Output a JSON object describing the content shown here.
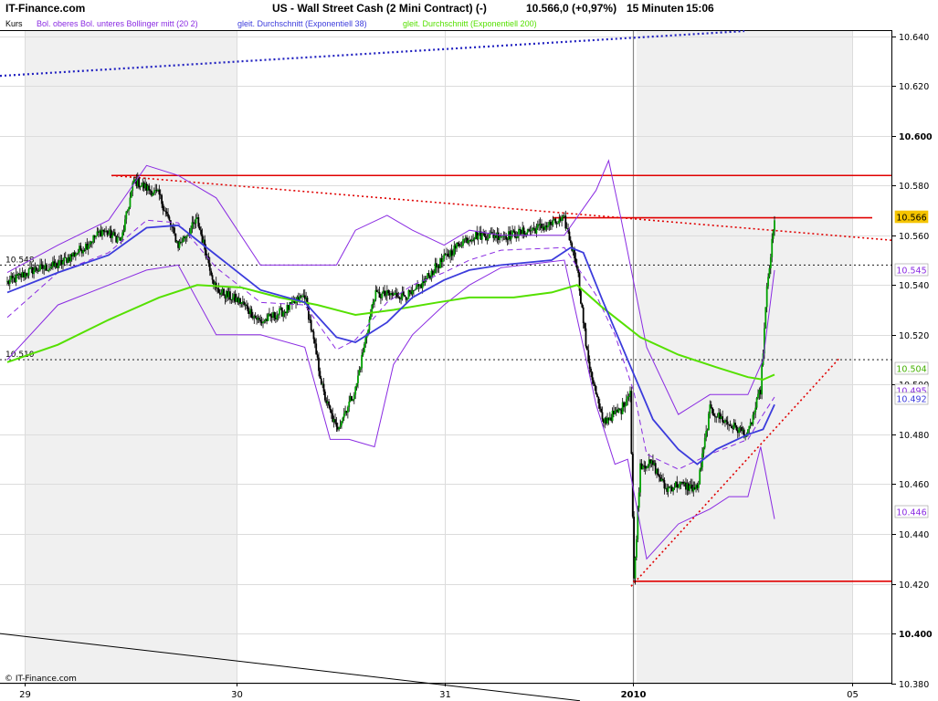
{
  "header": {
    "site": "IT-Finance.com",
    "title": "US - Wall Street Cash (2 Mini Contract) (-)",
    "quote": "10.566,0 (+0,97%)",
    "interval": "15 Minuten",
    "time": "15:06"
  },
  "legend": [
    {
      "text": "Kurs",
      "color": "#000000"
    },
    {
      "text": "Bol. oberes Bol. unteres Bollinger mitt (20 2)",
      "color": "#8a2be2"
    },
    {
      "text": "gleit. Durchschnitt (Exponentiell 38)",
      "color": "#3c3cdc"
    },
    {
      "text": "gleit. Durchschnitt (Exponentiell 200)",
      "color": "#55e000"
    }
  ],
  "copyright": "© IT-Finance.com",
  "colors": {
    "up_candle": "#00a000",
    "down_candle": "#000000",
    "bollinger": "#8a2be2",
    "ema38": "#3c3cdc",
    "ema200": "#55e000",
    "trend": "#e00000",
    "dotted_blue": "#2020c0",
    "shade": "#f0f0f0",
    "price_tag": "#f5c400"
  },
  "chart_data": {
    "type": "candlestick",
    "title": "US - Wall Street Cash (2 Mini Contract) (-)",
    "interval": "15 Minuten",
    "x_ticks": [
      "29",
      "30",
      "31",
      "2010",
      "05"
    ],
    "y_ticks": [
      "10.640",
      "10.620",
      "10.600",
      "10.580",
      "10.560",
      "10.540",
      "10.520",
      "10.500",
      "10.480",
      "10.460",
      "10.440",
      "10.420",
      "10.400",
      "10.380"
    ],
    "ylim": [
      10373,
      10645
    ],
    "current_price": 10566,
    "right_tags": [
      {
        "text": "10.566",
        "value": 10566,
        "kind": "price"
      },
      {
        "text": "10.545",
        "value": 10545,
        "kind": "bollinger"
      },
      {
        "text": "10.504",
        "value": 10504,
        "kind": "ema200"
      },
      {
        "text": "10.495",
        "value": 10495,
        "kind": "bollinger"
      },
      {
        "text": "10.492",
        "value": 10492,
        "kind": "ema38"
      },
      {
        "text": "10.446",
        "value": 10446,
        "kind": "bollinger"
      }
    ],
    "horizontal_lines": [
      {
        "label": "10.548",
        "value": 10548,
        "style": "dotted-black"
      },
      {
        "label": "10.510",
        "value": 10510,
        "style": "dotted-black"
      },
      {
        "value": 10584,
        "style": "solid-red"
      },
      {
        "value": 10567,
        "style": "solid-red"
      },
      {
        "value": 10421,
        "style": "solid-red"
      }
    ],
    "segments": [
      {
        "from": [
          0,
          10584
        ],
        "to": [
          1,
          10558
        ],
        "style": "dotted-red"
      },
      {
        "from": [
          0,
          10419
        ],
        "to": [
          1,
          10511
        ],
        "style": "dotted-red"
      },
      {
        "from": [
          0,
          10624
        ],
        "to": [
          1,
          10642
        ],
        "style": "dotted-blue"
      },
      {
        "from": [
          0,
          10400
        ],
        "to": [
          1,
          10373
        ],
        "style": "solid-black"
      }
    ],
    "anchors": [
      {
        "i": 0,
        "v": 10541
      },
      {
        "i": 20,
        "v": 10546
      },
      {
        "i": 40,
        "v": 10548
      },
      {
        "i": 60,
        "v": 10555
      },
      {
        "i": 75,
        "v": 10562
      },
      {
        "i": 90,
        "v": 10558
      },
      {
        "i": 100,
        "v": 10582
      },
      {
        "i": 120,
        "v": 10576
      },
      {
        "i": 135,
        "v": 10556
      },
      {
        "i": 150,
        "v": 10566
      },
      {
        "i": 165,
        "v": 10538
      },
      {
        "i": 185,
        "v": 10533
      },
      {
        "i": 200,
        "v": 10525
      },
      {
        "i": 220,
        "v": 10530
      },
      {
        "i": 235,
        "v": 10536
      },
      {
        "i": 250,
        "v": 10496
      },
      {
        "i": 260,
        "v": 10482
      },
      {
        "i": 275,
        "v": 10498
      },
      {
        "i": 290,
        "v": 10536
      },
      {
        "i": 305,
        "v": 10536
      },
      {
        "i": 320,
        "v": 10536
      },
      {
        "i": 340,
        "v": 10548
      },
      {
        "i": 360,
        "v": 10558
      },
      {
        "i": 370,
        "v": 10560
      },
      {
        "i": 380,
        "v": 10560
      },
      {
        "i": 398,
        "v": 10560
      },
      {
        "i": 420,
        "v": 10563
      },
      {
        "i": 440,
        "v": 10566
      },
      {
        "i": 450,
        "v": 10548
      },
      {
        "i": 458,
        "v": 10512
      },
      {
        "i": 470,
        "v": 10485
      },
      {
        "i": 485,
        "v": 10490
      },
      {
        "i": 492,
        "v": 10498
      },
      {
        "i": 495,
        "v": 10421
      },
      {
        "i": 500,
        "v": 10468
      },
      {
        "i": 510,
        "v": 10468
      },
      {
        "i": 520,
        "v": 10458
      },
      {
        "i": 530,
        "v": 10460
      },
      {
        "i": 545,
        "v": 10458
      },
      {
        "i": 555,
        "v": 10490
      },
      {
        "i": 570,
        "v": 10484
      },
      {
        "i": 585,
        "v": 10480
      },
      {
        "i": 595,
        "v": 10498
      },
      {
        "i": 600,
        "v": 10538
      },
      {
        "i": 606,
        "v": 10566
      }
    ],
    "bollinger_upper": [
      [
        0,
        10545
      ],
      [
        40,
        10556
      ],
      [
        80,
        10566
      ],
      [
        110,
        10588
      ],
      [
        135,
        10584
      ],
      [
        165,
        10575
      ],
      [
        200,
        10548
      ],
      [
        235,
        10548
      ],
      [
        260,
        10548
      ],
      [
        275,
        10562
      ],
      [
        300,
        10568
      ],
      [
        320,
        10562
      ],
      [
        345,
        10556
      ],
      [
        365,
        10562
      ],
      [
        390,
        10560
      ],
      [
        440,
        10560
      ],
      [
        465,
        10578
      ],
      [
        475,
        10590
      ],
      [
        485,
        10566
      ],
      [
        505,
        10515
      ],
      [
        530,
        10488
      ],
      [
        555,
        10496
      ],
      [
        585,
        10496
      ],
      [
        597,
        10510
      ],
      [
        606,
        10546
      ]
    ],
    "bollinger_lower": [
      [
        0,
        10510
      ],
      [
        40,
        10532
      ],
      [
        80,
        10540
      ],
      [
        110,
        10546
      ],
      [
        135,
        10548
      ],
      [
        165,
        10520
      ],
      [
        200,
        10520
      ],
      [
        235,
        10515
      ],
      [
        255,
        10478
      ],
      [
        270,
        10478
      ],
      [
        290,
        10475
      ],
      [
        305,
        10508
      ],
      [
        320,
        10520
      ],
      [
        345,
        10532
      ],
      [
        365,
        10540
      ],
      [
        390,
        10547
      ],
      [
        440,
        10550
      ],
      [
        465,
        10492
      ],
      [
        480,
        10468
      ],
      [
        490,
        10470
      ],
      [
        505,
        10430
      ],
      [
        530,
        10444
      ],
      [
        555,
        10450
      ],
      [
        570,
        10455
      ],
      [
        585,
        10455
      ],
      [
        595,
        10475
      ],
      [
        606,
        10446
      ]
    ],
    "bollinger_mid": [
      [
        0,
        10527
      ],
      [
        40,
        10545
      ],
      [
        80,
        10553
      ],
      [
        110,
        10566
      ],
      [
        135,
        10565
      ],
      [
        165,
        10547
      ],
      [
        200,
        10533
      ],
      [
        235,
        10532
      ],
      [
        260,
        10514
      ],
      [
        275,
        10518
      ],
      [
        300,
        10533
      ],
      [
        320,
        10540
      ],
      [
        345,
        10545
      ],
      [
        365,
        10550
      ],
      [
        390,
        10554
      ],
      [
        440,
        10555
      ],
      [
        465,
        10536
      ],
      [
        480,
        10520
      ],
      [
        495,
        10497
      ],
      [
        505,
        10472
      ],
      [
        530,
        10466
      ],
      [
        555,
        10472
      ],
      [
        585,
        10478
      ],
      [
        597,
        10488
      ],
      [
        606,
        10495
      ]
    ],
    "ema38": [
      [
        0,
        10537
      ],
      [
        40,
        10545
      ],
      [
        80,
        10552
      ],
      [
        110,
        10563
      ],
      [
        135,
        10564
      ],
      [
        165,
        10552
      ],
      [
        200,
        10538
      ],
      [
        235,
        10533
      ],
      [
        260,
        10519
      ],
      [
        275,
        10517
      ],
      [
        300,
        10525
      ],
      [
        320,
        10535
      ],
      [
        345,
        10542
      ],
      [
        365,
        10546
      ],
      [
        390,
        10548
      ],
      [
        430,
        10550
      ],
      [
        445,
        10555
      ],
      [
        455,
        10553
      ],
      [
        470,
        10534
      ],
      [
        490,
        10510
      ],
      [
        510,
        10486
      ],
      [
        530,
        10474
      ],
      [
        545,
        10468
      ],
      [
        560,
        10474
      ],
      [
        585,
        10480
      ],
      [
        597,
        10482
      ],
      [
        606,
        10492
      ]
    ],
    "ema200": [
      [
        0,
        10509
      ],
      [
        40,
        10516
      ],
      [
        80,
        10526
      ],
      [
        120,
        10535
      ],
      [
        150,
        10540
      ],
      [
        185,
        10539
      ],
      [
        215,
        10535
      ],
      [
        245,
        10532
      ],
      [
        275,
        10528
      ],
      [
        305,
        10530
      ],
      [
        340,
        10533
      ],
      [
        365,
        10535
      ],
      [
        400,
        10535
      ],
      [
        430,
        10537
      ],
      [
        450,
        10540
      ],
      [
        470,
        10531
      ],
      [
        500,
        10519
      ],
      [
        530,
        10512
      ],
      [
        560,
        10507
      ],
      [
        585,
        10503
      ],
      [
        597,
        10502
      ],
      [
        606,
        10504
      ]
    ]
  }
}
